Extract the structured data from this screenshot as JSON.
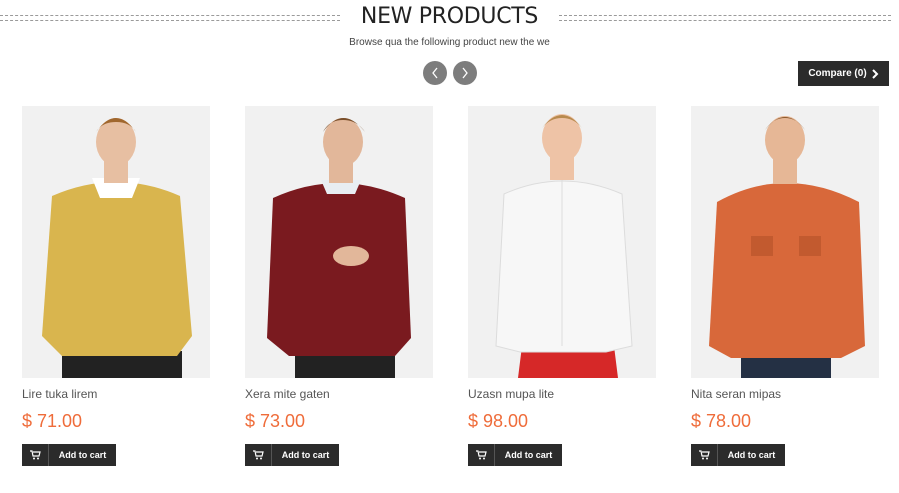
{
  "header": {
    "title": "NEW PRODUCTS",
    "subtitle": "Browse qua the following product new the we"
  },
  "carousel": {
    "prev_icon": "chevron-left-icon",
    "next_icon": "chevron-right-icon"
  },
  "compare": {
    "label": "Compare (0)",
    "icon": "chevron-right-icon"
  },
  "colors": {
    "price": "#ef6c3a",
    "button_bg": "#2b2b2b",
    "arrow_bg": "#7d7d7d"
  },
  "products": [
    {
      "name": "Lire tuka lirem",
      "price": "$ 71.00",
      "cart_label": "Add to cart",
      "garment_color": "#d9b54e"
    },
    {
      "name": "Xera mite gaten",
      "price": "$ 73.00",
      "cart_label": "Add to cart",
      "garment_color": "#7a1a1f"
    },
    {
      "name": "Uzasn mupa lite",
      "price": "$ 98.00",
      "cart_label": "Add to cart",
      "garment_color": "#f7f7f7"
    },
    {
      "name": "Nita seran mipas",
      "price": "$ 78.00",
      "cart_label": "Add to cart",
      "garment_color": "#d8683a"
    }
  ]
}
